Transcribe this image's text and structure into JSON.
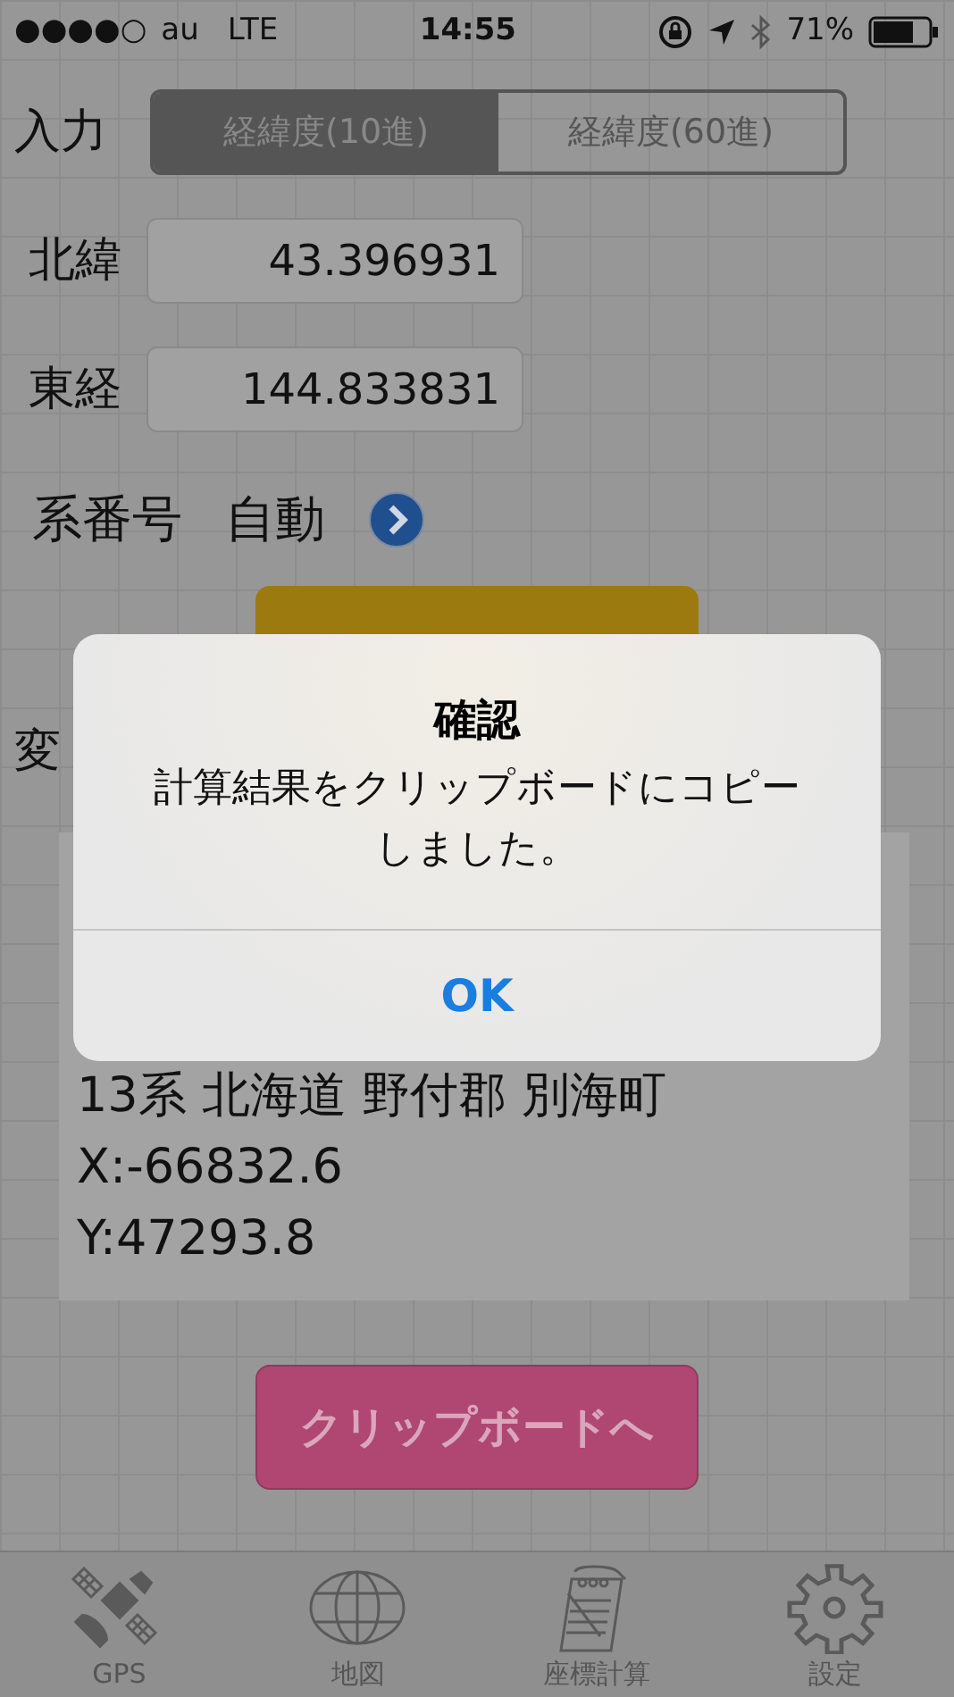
{
  "status_bar": {
    "signal": "●●●●○",
    "carrier": "au",
    "network": "LTE",
    "time": "14:55",
    "battery": "71%"
  },
  "input": {
    "label": "入力",
    "segments": [
      {
        "label": "経緯度(10進)",
        "selected": true
      },
      {
        "label": "経緯度(60進)",
        "selected": false
      }
    ]
  },
  "fields": [
    {
      "label": "北緯",
      "value": "43.396931"
    },
    {
      "label": "東経",
      "value": "144.833831"
    }
  ],
  "zone": {
    "label": "系番号",
    "value": "自動"
  },
  "result_label": "変",
  "result_lines": [
    "13系 北海道 野付郡 別海町",
    "X:-66832.6",
    "Y:47293.8"
  ],
  "clipboard_button": "クリップボードへ",
  "alert": {
    "title": "確認",
    "message": "計算結果をクリップボードにコピーしました。",
    "button": "OK"
  },
  "tabs": [
    {
      "label": "GPS",
      "kind": "satellite",
      "selected": false
    },
    {
      "label": "地図",
      "kind": "globe",
      "selected": false
    },
    {
      "label": "座標計算",
      "kind": "notepad",
      "selected": false
    },
    {
      "label": "設定",
      "kind": "gear",
      "selected": false
    }
  ]
}
